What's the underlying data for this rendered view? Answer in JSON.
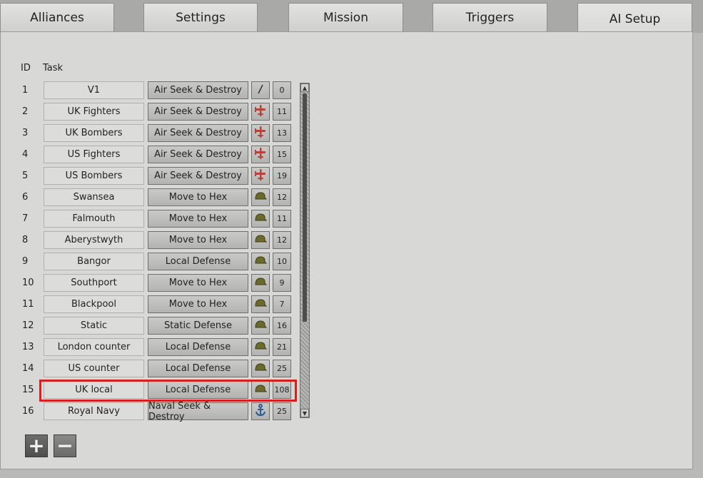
{
  "tabs": [
    {
      "label": "Alliances",
      "active": false
    },
    {
      "label": "Settings",
      "active": false
    },
    {
      "label": "Mission",
      "active": false
    },
    {
      "label": "Triggers",
      "active": false
    },
    {
      "label": "AI Setup",
      "active": true
    }
  ],
  "table": {
    "headers": {
      "id": "ID",
      "task": "Task"
    },
    "rows": [
      {
        "id": "1",
        "name": "V1",
        "task": "Air Seek & Destroy",
        "icon": "slash-icon",
        "num": "0"
      },
      {
        "id": "2",
        "name": "UK Fighters",
        "task": "Air Seek & Destroy",
        "icon": "plane-icon",
        "num": "11"
      },
      {
        "id": "3",
        "name": "UK Bombers",
        "task": "Air Seek & Destroy",
        "icon": "plane-icon",
        "num": "13"
      },
      {
        "id": "4",
        "name": "US Fighters",
        "task": "Air Seek & Destroy",
        "icon": "plane-icon",
        "num": "15"
      },
      {
        "id": "5",
        "name": "US Bombers",
        "task": "Air Seek & Destroy",
        "icon": "plane-icon",
        "num": "19"
      },
      {
        "id": "6",
        "name": "Swansea",
        "task": "Move to Hex",
        "icon": "helmet-icon",
        "num": "12"
      },
      {
        "id": "7",
        "name": "Falmouth",
        "task": "Move to Hex",
        "icon": "helmet-icon",
        "num": "11"
      },
      {
        "id": "8",
        "name": "Aberystwyth",
        "task": "Move to Hex",
        "icon": "helmet-icon",
        "num": "12"
      },
      {
        "id": "9",
        "name": "Bangor",
        "task": "Local Defense",
        "icon": "helmet-icon",
        "num": "10"
      },
      {
        "id": "10",
        "name": "Southport",
        "task": "Move to Hex",
        "icon": "helmet-icon",
        "num": "9"
      },
      {
        "id": "11",
        "name": "Blackpool",
        "task": "Move to Hex",
        "icon": "helmet-icon",
        "num": "7"
      },
      {
        "id": "12",
        "name": "Static",
        "task": "Static Defense",
        "icon": "helmet-icon",
        "num": "16"
      },
      {
        "id": "13",
        "name": "London counter",
        "task": "Local Defense",
        "icon": "helmet-icon",
        "num": "21"
      },
      {
        "id": "14",
        "name": "US counter",
        "task": "Local Defense",
        "icon": "helmet-icon",
        "num": "25"
      },
      {
        "id": "15",
        "name": "UK local",
        "task": "Local Defense",
        "icon": "helmet-icon",
        "num": "108",
        "highlighted": true
      },
      {
        "id": "16",
        "name": "Royal Navy",
        "task": "Naval Seek & Destroy",
        "icon": "anchor-icon",
        "num": "25"
      }
    ]
  },
  "buttons": {
    "add": "+",
    "remove": "−"
  },
  "colors": {
    "highlight": "#d81f1f",
    "plane": "#b5453a",
    "helmet": "#6b6a2a",
    "anchor": "#2f5b9a"
  }
}
